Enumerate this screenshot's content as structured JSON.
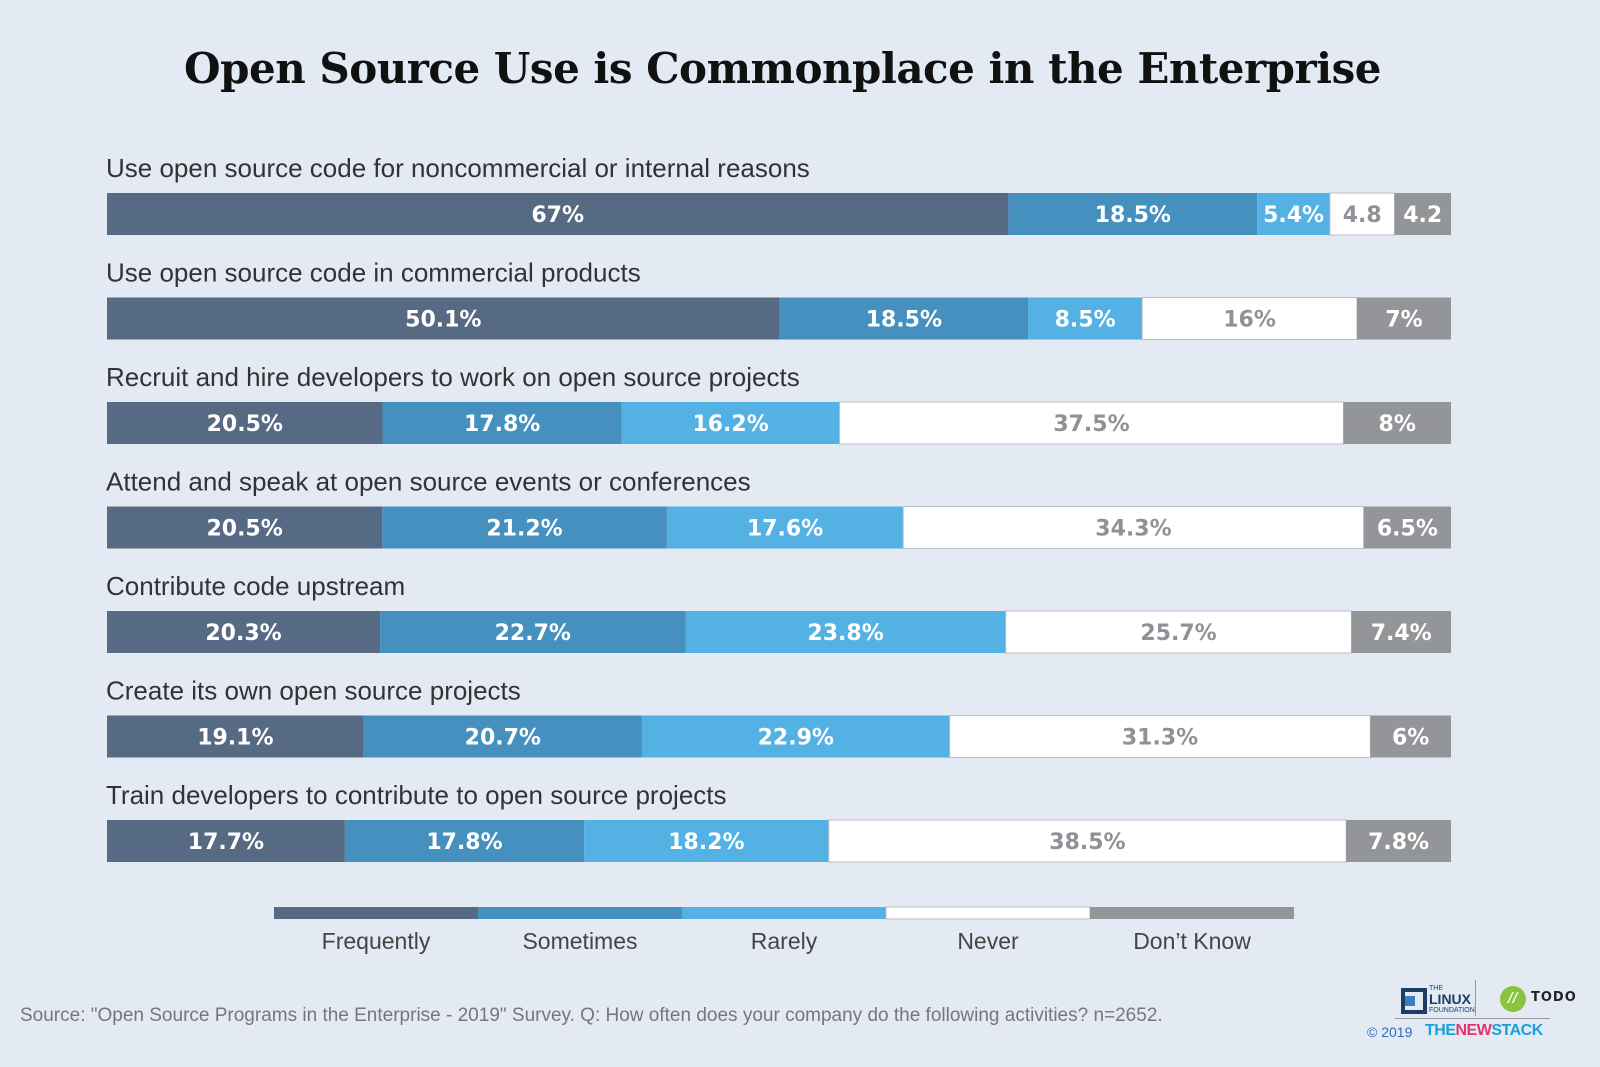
{
  "chart_data": {
    "type": "bar",
    "orientation": "horizontal",
    "stacked": true,
    "title": "Open Source Use is Commonplace in the Enterprise",
    "xlabel": "",
    "ylabel": "",
    "xlim": [
      0,
      100
    ],
    "grid": false,
    "legend_position": "bottom",
    "categories": [
      "Use open source code for noncommercial or internal reasons",
      "Use open source code in commercial products",
      "Recruit and hire developers to work on open source projects",
      "Attend and speak at open source events or conferences",
      "Contribute code upstream",
      "Create its own open source projects",
      "Train developers to contribute to open source projects"
    ],
    "series": [
      {
        "name": "Frequently",
        "color": "#576a84",
        "text_color": "#ffffff",
        "values": [
          67,
          50.1,
          20.5,
          20.5,
          20.3,
          19.1,
          17.7
        ],
        "labels": [
          "67%",
          "50.1%",
          "20.5%",
          "20.5%",
          "20.3%",
          "19.1%",
          "17.7%"
        ]
      },
      {
        "name": "Sometimes",
        "color": "#4590be",
        "text_color": "#ffffff",
        "values": [
          18.5,
          18.5,
          17.8,
          21.2,
          22.7,
          20.7,
          17.8
        ],
        "labels": [
          "18.5%",
          "18.5%",
          "17.8%",
          "21.2%",
          "22.7%",
          "20.7%",
          "17.8%"
        ]
      },
      {
        "name": "Rarely",
        "color": "#53b1e4",
        "text_color": "#ffffff",
        "values": [
          5.4,
          8.5,
          16.2,
          17.6,
          23.8,
          22.9,
          18.2
        ],
        "labels": [
          "5.4%",
          "8.5%",
          "16.2%",
          "17.6%",
          "23.8%",
          "22.9%",
          "18.2%"
        ]
      },
      {
        "name": "Never",
        "color": "#ffffff",
        "text_color": "#8f9196",
        "values": [
          4.8,
          16,
          37.5,
          34.3,
          25.7,
          31.3,
          38.5
        ],
        "labels": [
          "4.8",
          "16%",
          "37.5%",
          "34.3%",
          "25.7%",
          "31.3%",
          "38.5%"
        ]
      },
      {
        "name": "Don’t Know",
        "color": "#939598",
        "text_color": "#ffffff",
        "values": [
          4.2,
          7,
          8,
          6.5,
          7.4,
          6,
          7.8
        ],
        "labels": [
          "4.2",
          "7%",
          "8%",
          "6.5%",
          "7.4%",
          "6%",
          "7.8%"
        ]
      }
    ],
    "source": "Source: \"Open Source Programs in the Enterprise - 2019\" Survey. Q: How often does your company do the following activities? n=2652."
  },
  "footer": {
    "lf_the": "THE",
    "lf_linux": "LINUX",
    "lf_foundation": "FOUNDATION",
    "todo_mark": "//",
    "todo_text": "TODO",
    "copyright": "© 2019",
    "tns_the": "THE",
    "tns_new": "NEW",
    "tns_stack": "STACK"
  }
}
